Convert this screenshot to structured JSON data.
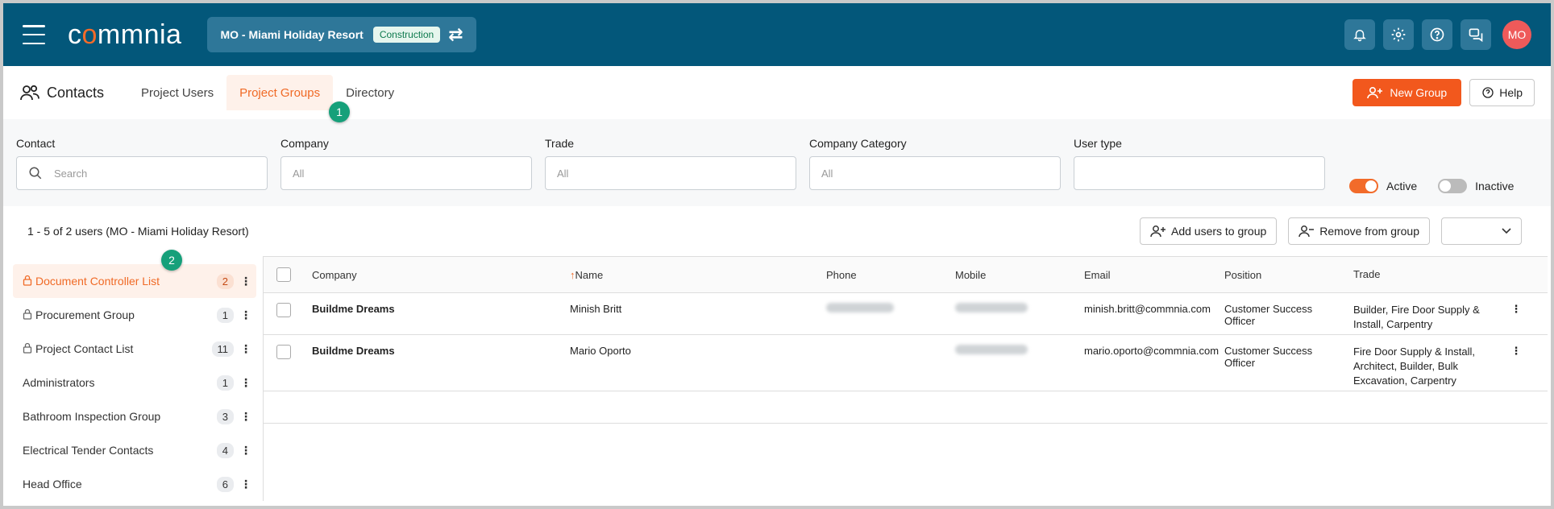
{
  "topbar": {
    "logo_text": "commnia",
    "project_name": "MO - Miami Holiday Resort",
    "project_badge": "Construction",
    "avatar_initials": "MO",
    "colors": {
      "bar": "#03577a",
      "accent": "#f26b2a"
    }
  },
  "header": {
    "title": "Contacts",
    "tabs": [
      {
        "label": "Project Users",
        "active": false
      },
      {
        "label": "Project Groups",
        "active": true
      },
      {
        "label": "Directory",
        "active": false
      }
    ],
    "new_group_label": "New Group",
    "help_label": "Help"
  },
  "steps": {
    "one": "1",
    "two": "2"
  },
  "filters": {
    "contact_label": "Contact",
    "contact_placeholder": "Search",
    "company_label": "Company",
    "company_value": "All",
    "trade_label": "Trade",
    "trade_value": "All",
    "category_label": "Company Category",
    "category_value": "All",
    "usertype_label": "User type",
    "usertype_value": "",
    "active_label": "Active",
    "inactive_label": "Inactive"
  },
  "summary": {
    "count_text": "1 - 5 of 2 users (MO - Miami Holiday Resort)",
    "add_label": "Add users to group",
    "remove_label": "Remove from group"
  },
  "groups": [
    {
      "name": "Document Controller List",
      "count": "2",
      "locked": true,
      "active": true
    },
    {
      "name": "Procurement Group",
      "count": "1",
      "locked": true,
      "active": false
    },
    {
      "name": "Project Contact List",
      "count": "11",
      "locked": true,
      "active": false
    },
    {
      "name": "Administrators",
      "count": "1",
      "locked": false,
      "active": false
    },
    {
      "name": "Bathroom Inspection Group",
      "count": "3",
      "locked": false,
      "active": false
    },
    {
      "name": "Electrical Tender Contacts",
      "count": "4",
      "locked": false,
      "active": false
    },
    {
      "name": "Head Office",
      "count": "6",
      "locked": false,
      "active": false
    }
  ],
  "table": {
    "headers": {
      "company": "Company",
      "name": "Name",
      "phone": "Phone",
      "mobile": "Mobile",
      "email": "Email",
      "position": "Position",
      "trade": "Trade"
    },
    "rows": [
      {
        "company": "Buildme Dreams",
        "name": "Minish Britt",
        "email": "minish.britt@commnia.com",
        "position": "Customer Success Officer",
        "trade": "Builder, Fire Door Supply & Install, Carpentry"
      },
      {
        "company": "Buildme Dreams",
        "name": "Mario Oporto",
        "email": "mario.oporto@commnia.com",
        "position": "Customer Success Officer",
        "trade": "Fire Door Supply & Install, Architect, Builder, Bulk Excavation, Carpentry"
      }
    ]
  }
}
